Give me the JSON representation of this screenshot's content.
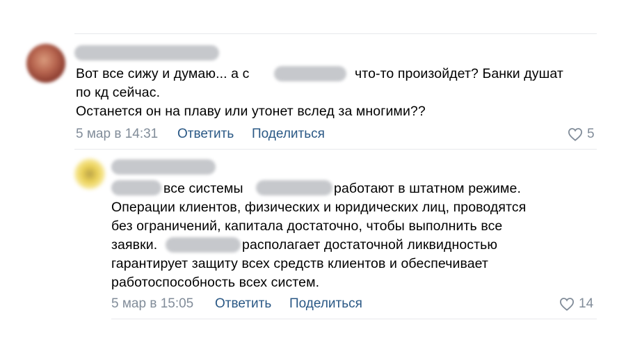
{
  "comments": [
    {
      "line1_a": "Вот все сижу и думаю... а с",
      "line1_b": "что-то произойдет? Банки душат",
      "line2": "по кд сейчас.",
      "line3": "Останется он на плаву или утонет вслед за многими??",
      "date": "5 мар в 14:31",
      "reply_label": "Ответить",
      "share_label": "Поделиться",
      "likes": "5"
    },
    {
      "line1_a": "все системы",
      "line1_b": "работают в штатном режиме.",
      "line2": "Операции клиентов, физических и юридических лиц, проводятся",
      "line3": "без ограничений, капитала достаточно, чтобы выполнить все",
      "line4_a": "заявки.",
      "line4_b": "располагает достаточной ликвидностью",
      "line5": "гарантирует защиту всех средств клиентов и обеспечивает",
      "line6": "работоспособность всех систем.",
      "date": "5 мар в 15:05",
      "reply_label": "Ответить",
      "share_label": "Поделиться",
      "likes": "14"
    }
  ],
  "colors": {
    "link": "#2a5885",
    "meta": "#818c99",
    "divider": "#e7e8ec",
    "redaction": "#c6c8cc"
  },
  "icons": {
    "like": "heart-outline-icon"
  }
}
